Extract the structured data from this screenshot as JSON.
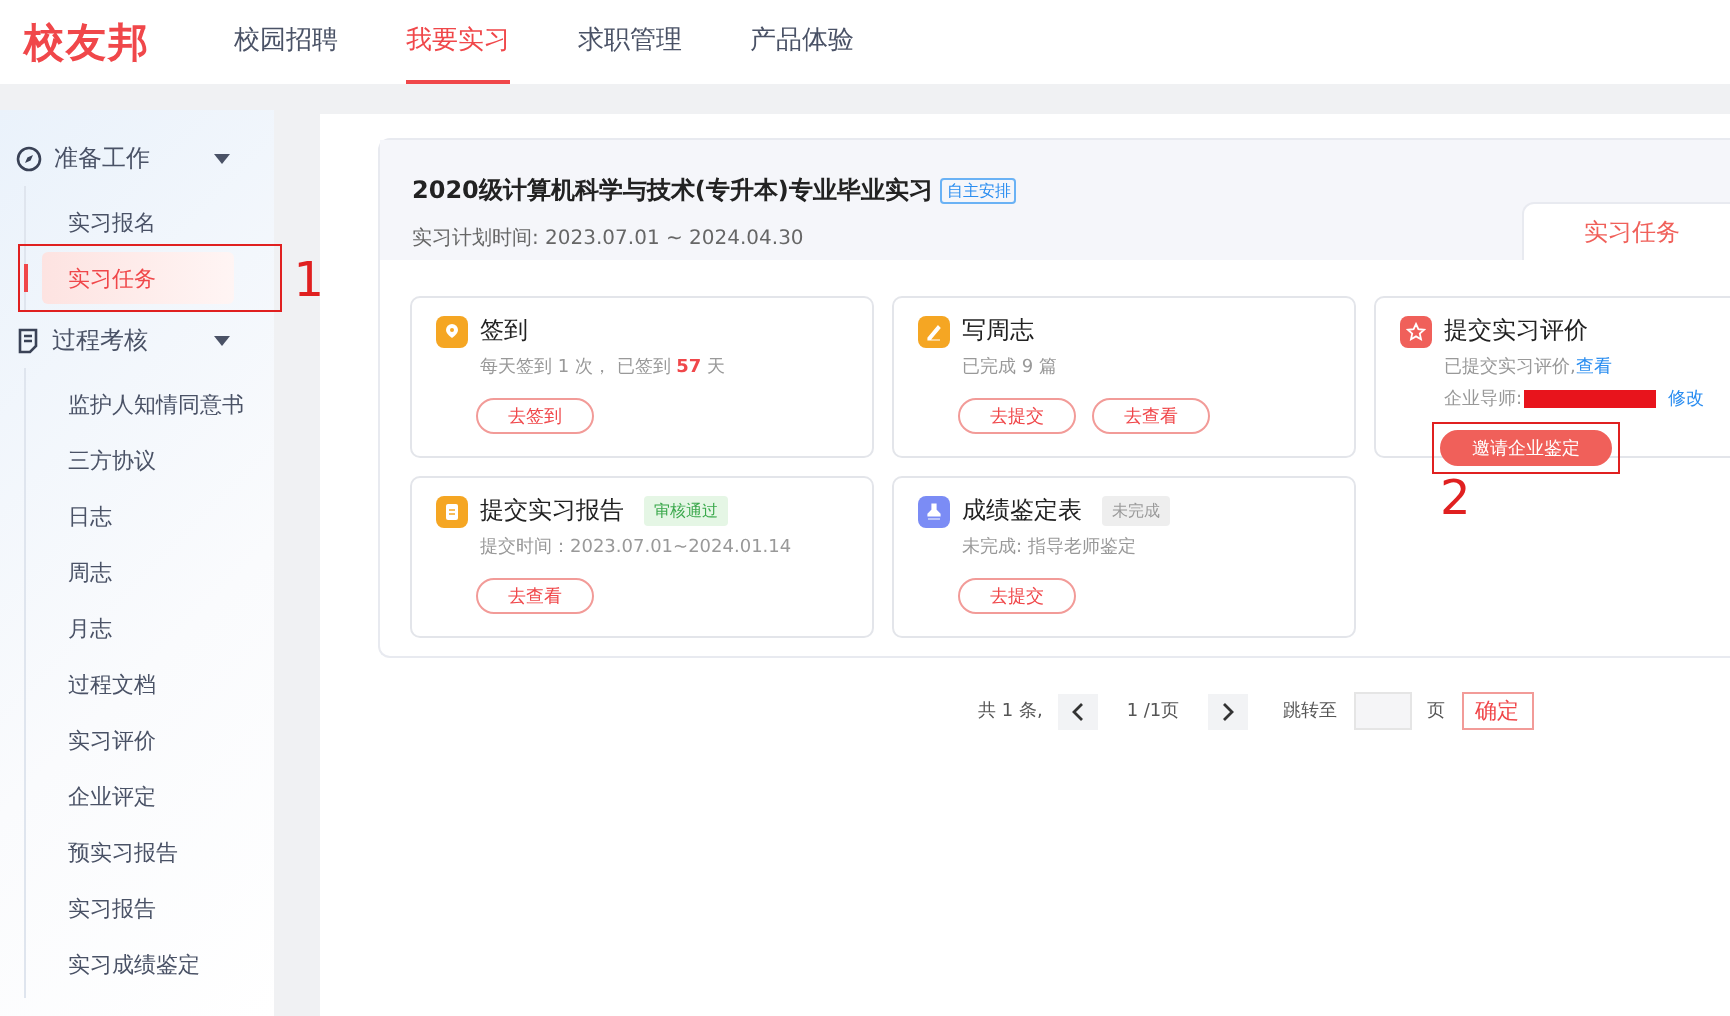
{
  "header": {
    "logo": "校友邦",
    "nav": [
      {
        "label": "校园招聘",
        "selected": false
      },
      {
        "label": "我要实习",
        "selected": true
      },
      {
        "label": "求职管理",
        "selected": false
      },
      {
        "label": "产品体验",
        "selected": false
      }
    ]
  },
  "sidebar": {
    "groups": [
      {
        "label": "准备工作",
        "expanded": true,
        "children": [
          {
            "label": "实习报名",
            "selected": false
          },
          {
            "label": "实习任务",
            "selected": true,
            "annotation": "1"
          }
        ]
      },
      {
        "label": "过程考核",
        "expanded": true,
        "children": [
          {
            "label": "监护人知情同意书",
            "selected": false
          },
          {
            "label": "三方协议",
            "selected": false
          },
          {
            "label": "日志",
            "selected": false
          },
          {
            "label": "周志",
            "selected": false
          },
          {
            "label": "月志",
            "selected": false
          },
          {
            "label": "过程文档",
            "selected": false
          },
          {
            "label": "实习评价",
            "selected": false
          },
          {
            "label": "企业评定",
            "selected": false
          },
          {
            "label": "预实习报告",
            "selected": false
          },
          {
            "label": "实习报告",
            "selected": false
          },
          {
            "label": "实习成绩鉴定",
            "selected": false
          }
        ]
      }
    ]
  },
  "internship": {
    "title": "2020级计算机科学与技术(专升本)专业毕业实习",
    "tag": "自主安排",
    "period": "实习计划时间: 2023.07.01 ~ 2024.04.30",
    "tabs": [
      {
        "label": "实习任务",
        "selected": true
      }
    ],
    "tasks": [
      {
        "color": "#f5a623",
        "title": "签到",
        "lines": [
          {
            "text": "每天签到 1 次， 已签到 **57** 天"
          }
        ],
        "buttons": [
          {
            "label": "去签到",
            "primary": false
          }
        ]
      },
      {
        "color": "#f5a623",
        "title": "写周志",
        "lines": [
          {
            "text": "已完成 9 篇"
          }
        ],
        "buttons": [
          {
            "label": "去提交",
            "primary": false
          },
          {
            "label": "去查看",
            "primary": false
          }
        ]
      },
      {
        "color": "#f0605a",
        "title": "提交实习评价",
        "lines": [
          {
            "text": "已提交实习评价, ",
            "link": "查看"
          },
          {
            "text": "企业导师: ",
            "redacted": true,
            "link": "修改"
          }
        ],
        "buttons": [
          {
            "label": "邀请企业鉴定",
            "primary": true,
            "annotation": "2"
          }
        ]
      },
      {
        "color": "#f5a623",
        "title": "提交实习报告",
        "badge": {
          "text": "审核通过",
          "kind": "success"
        },
        "lines": [
          {
            "text": "提交时间：2023.07.01~2024.01.14"
          }
        ],
        "buttons": [
          {
            "label": "去查看",
            "primary": false
          }
        ]
      },
      {
        "color": "#7b8cf5",
        "title": "成绩鉴定表",
        "badge": {
          "text": "未完成",
          "kind": "neutral"
        },
        "lines": [
          {
            "text": "未完成: 指导老师鉴定"
          }
        ],
        "buttons": [
          {
            "label": "去提交",
            "primary": false
          }
        ]
      }
    ]
  },
  "pagination": {
    "total": "共 1 条,",
    "page": "1 /1页",
    "jump_label": "跳转至",
    "jump_unit": "页",
    "confirm": "确定"
  }
}
